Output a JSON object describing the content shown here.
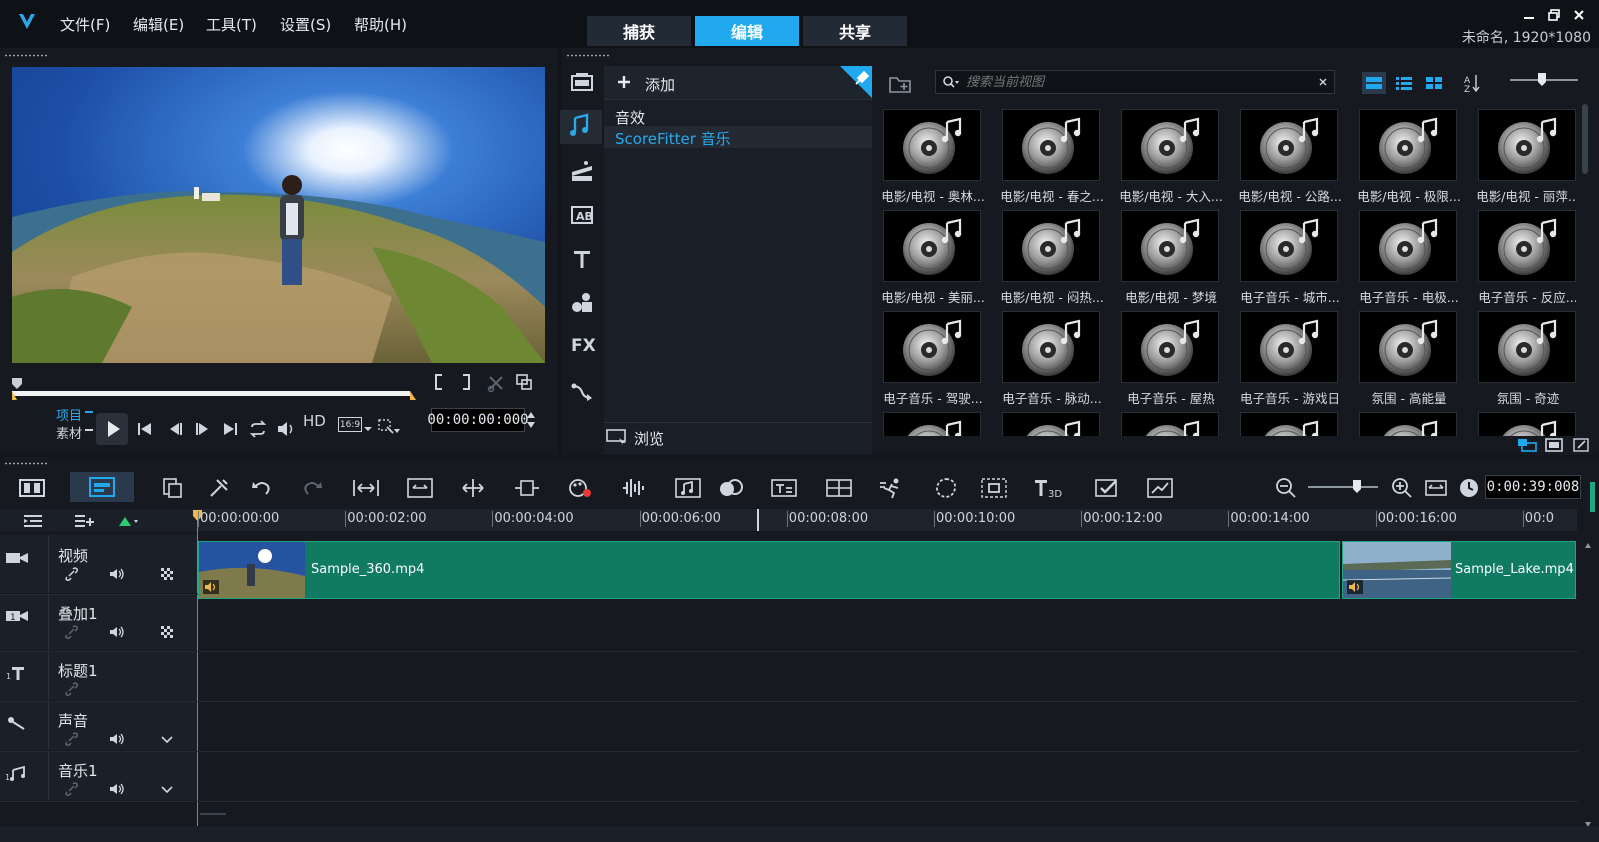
{
  "menubar": {
    "logo": "V",
    "items": [
      "文件(F)",
      "编辑(E)",
      "工具(T)",
      "设置(S)",
      "帮助(H)"
    ],
    "tabs": [
      "捕获",
      "编辑",
      "共享"
    ],
    "active_tab": "编辑",
    "project_info": "未命名, 1920*1080"
  },
  "player": {
    "label_project": "项目",
    "label_clip": "素材",
    "hd": "HD",
    "aspect": "16:9",
    "timecode": "00:00:00:000"
  },
  "library": {
    "add_label": "添加",
    "categories": [
      "音效",
      "ScoreFitter 音乐"
    ],
    "selected_category": "ScoreFitter 音乐",
    "browse_label": "浏览",
    "search_placeholder": "搜索当前视图",
    "sidebar_fx": "FX",
    "items": [
      "电影/电视 - 奥林...",
      "电影/电视 - 春之...",
      "电影/电视 - 大入...",
      "电影/电视 - 公路...",
      "电影/电视 - 极限...",
      "电影/电视 - 丽萍...",
      "电影/电视 - 美丽...",
      "电影/电视 - 闷热...",
      "电影/电视 - 梦境",
      "电子音乐 - 城市...",
      "电子音乐 - 电极...",
      "电子音乐 - 反应...",
      "电子音乐 - 驾驶...",
      "电子音乐 - 脉动...",
      "电子音乐 - 屋热",
      "电子音乐 - 游戏日",
      "氛围 - 高能量",
      "氛围 - 奇迹"
    ]
  },
  "timeline": {
    "duration": "0:00:39:008",
    "ruler": [
      "00:00:00:00",
      "00:00:02:00",
      "00:00:04:00",
      "00:00:06:00",
      "00:00:08:00",
      "00:00:10:00",
      "00:00:12:00",
      "00:00:14:00",
      "00:00:16:00",
      "00:0"
    ],
    "tracks": [
      "视频",
      "叠加1",
      "标题1",
      "声音",
      "音乐1"
    ],
    "clips": [
      {
        "name": "Sample_360.mp4"
      },
      {
        "name": "Sample_Lake.mp4"
      }
    ]
  },
  "colors": {
    "accent": "#20a9ee",
    "clip": "#117a63",
    "bg": "#161a20"
  }
}
